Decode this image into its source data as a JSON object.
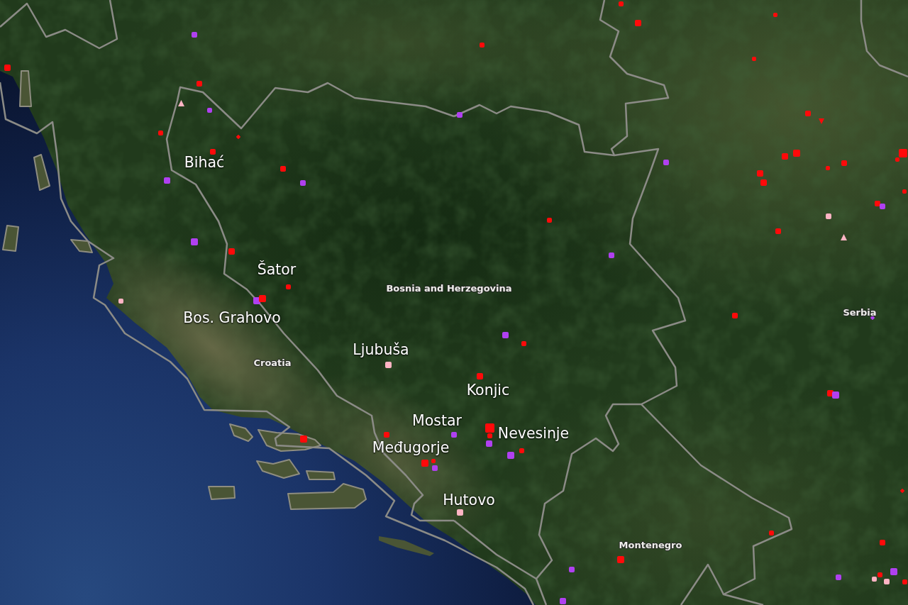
{
  "map": {
    "labels": [
      {
        "kind": "city",
        "text": "Bihać"
      },
      {
        "kind": "city",
        "text": "Šator"
      },
      {
        "kind": "country",
        "text": "Bosnia and Herzegovina"
      },
      {
        "kind": "city",
        "text": "Bos. Grahovo"
      },
      {
        "kind": "country",
        "text": "Serbia"
      },
      {
        "kind": "city",
        "text": "Ljubuša"
      },
      {
        "kind": "country",
        "text": "Croatia"
      },
      {
        "kind": "city",
        "text": "Konjic"
      },
      {
        "kind": "city",
        "text": "Mostar"
      },
      {
        "kind": "city",
        "text": "Nevesinje"
      },
      {
        "kind": "city",
        "text": "Međugorje"
      },
      {
        "kind": "city",
        "text": "Hutovo"
      },
      {
        "kind": "country",
        "text": "Montenegro"
      }
    ],
    "fire_markers": [
      {
        "kind": "square",
        "color": "#b040f0"
      },
      {
        "kind": "square",
        "color": "#ff0a0a"
      },
      {
        "kind": "square",
        "color": "#ff0a0a"
      },
      {
        "kind": "triangle",
        "color": "#ffb4c4"
      },
      {
        "kind": "square",
        "color": "#b040f0"
      },
      {
        "kind": "square",
        "color": "#ff0a0a"
      },
      {
        "kind": "diamond",
        "color": "#ff0a0a"
      },
      {
        "kind": "square",
        "color": "#ff0a0a"
      },
      {
        "kind": "square",
        "color": "#ff0a0a"
      },
      {
        "kind": "square",
        "color": "#b040f0"
      },
      {
        "kind": "square",
        "color": "#b040f0"
      },
      {
        "kind": "square",
        "color": "#b040f0"
      },
      {
        "kind": "square",
        "color": "#ff0a0a"
      },
      {
        "kind": "square",
        "color": "#ff0a0a"
      },
      {
        "kind": "square",
        "color": "#b040f0"
      },
      {
        "kind": "square",
        "color": "#ff0a0a"
      },
      {
        "kind": "square",
        "color": "#ffb4c4"
      },
      {
        "kind": "square",
        "color": "#ff0a0a"
      },
      {
        "kind": "square",
        "color": "#ff0a0a"
      },
      {
        "kind": "square",
        "color": "#ff0a0a"
      },
      {
        "kind": "square",
        "color": "#ff0a0a"
      },
      {
        "kind": "square",
        "color": "#ff0a0a"
      },
      {
        "kind": "square",
        "color": "#b040f0"
      },
      {
        "kind": "square",
        "color": "#b040f0"
      },
      {
        "kind": "square",
        "color": "#ff0a0a"
      },
      {
        "kind": "square",
        "color": "#b040f0"
      },
      {
        "kind": "square",
        "color": "#ff0a0a"
      },
      {
        "kind": "triangle-down",
        "color": "#ff0a0a"
      },
      {
        "kind": "square",
        "color": "#ff0a0a"
      },
      {
        "kind": "square",
        "color": "#ff0a0a"
      },
      {
        "kind": "square",
        "color": "#ff0a0a"
      },
      {
        "kind": "square",
        "color": "#ff0a0a"
      },
      {
        "kind": "square",
        "color": "#ff0a0a"
      },
      {
        "kind": "square",
        "color": "#ff0a0a"
      },
      {
        "kind": "square",
        "color": "#ff0a0a"
      },
      {
        "kind": "square",
        "color": "#ff0a0a"
      },
      {
        "kind": "square",
        "color": "#ff0a0a"
      },
      {
        "kind": "square",
        "color": "#b040f0"
      },
      {
        "kind": "square",
        "color": "#ffb4c4"
      },
      {
        "kind": "triangle",
        "color": "#ffb4c4"
      },
      {
        "kind": "square",
        "color": "#ff0a0a"
      },
      {
        "kind": "square",
        "color": "#ff0a0a"
      },
      {
        "kind": "diamond",
        "color": "#b040f0"
      },
      {
        "kind": "square",
        "color": "#b040f0"
      },
      {
        "kind": "square",
        "color": "#ff0a0a"
      },
      {
        "kind": "square",
        "color": "#ff0a0a"
      },
      {
        "kind": "square",
        "color": "#ffb4c4"
      },
      {
        "kind": "square",
        "color": "#ff0a0a"
      },
      {
        "kind": "square",
        "color": "#b040f0"
      },
      {
        "kind": "square",
        "color": "#ff0a0a"
      },
      {
        "kind": "square",
        "color": "#ff0a0a"
      },
      {
        "kind": "square",
        "color": "#b040f0"
      },
      {
        "kind": "square",
        "color": "#ff0a0a"
      },
      {
        "kind": "square",
        "color": "#b040f0"
      },
      {
        "kind": "square",
        "color": "#ff0a0a"
      },
      {
        "kind": "square",
        "color": "#ff0a0a"
      },
      {
        "kind": "square",
        "color": "#ff0a0a"
      },
      {
        "kind": "square",
        "color": "#b040f0"
      },
      {
        "kind": "square",
        "color": "#ffb4c4"
      },
      {
        "kind": "square",
        "color": "#ff0a0a"
      },
      {
        "kind": "square",
        "color": "#b040f0"
      },
      {
        "kind": "diamond",
        "color": "#ff0a0a"
      },
      {
        "kind": "square",
        "color": "#ff0a0a"
      },
      {
        "kind": "square",
        "color": "#ff0a0a"
      },
      {
        "kind": "square",
        "color": "#ff0a0a"
      },
      {
        "kind": "square",
        "color": "#b040f0"
      },
      {
        "kind": "square",
        "color": "#b040f0"
      },
      {
        "kind": "square",
        "color": "#b040f0"
      },
      {
        "kind": "square",
        "color": "#b040f0"
      },
      {
        "kind": "square",
        "color": "#ff0a0a"
      },
      {
        "kind": "square",
        "color": "#ffb4c4"
      },
      {
        "kind": "square",
        "color": "#ffb4c4"
      },
      {
        "kind": "square",
        "color": "#ff0a0a"
      },
      {
        "kind": "square",
        "color": "#ff0a0a"
      }
    ]
  }
}
